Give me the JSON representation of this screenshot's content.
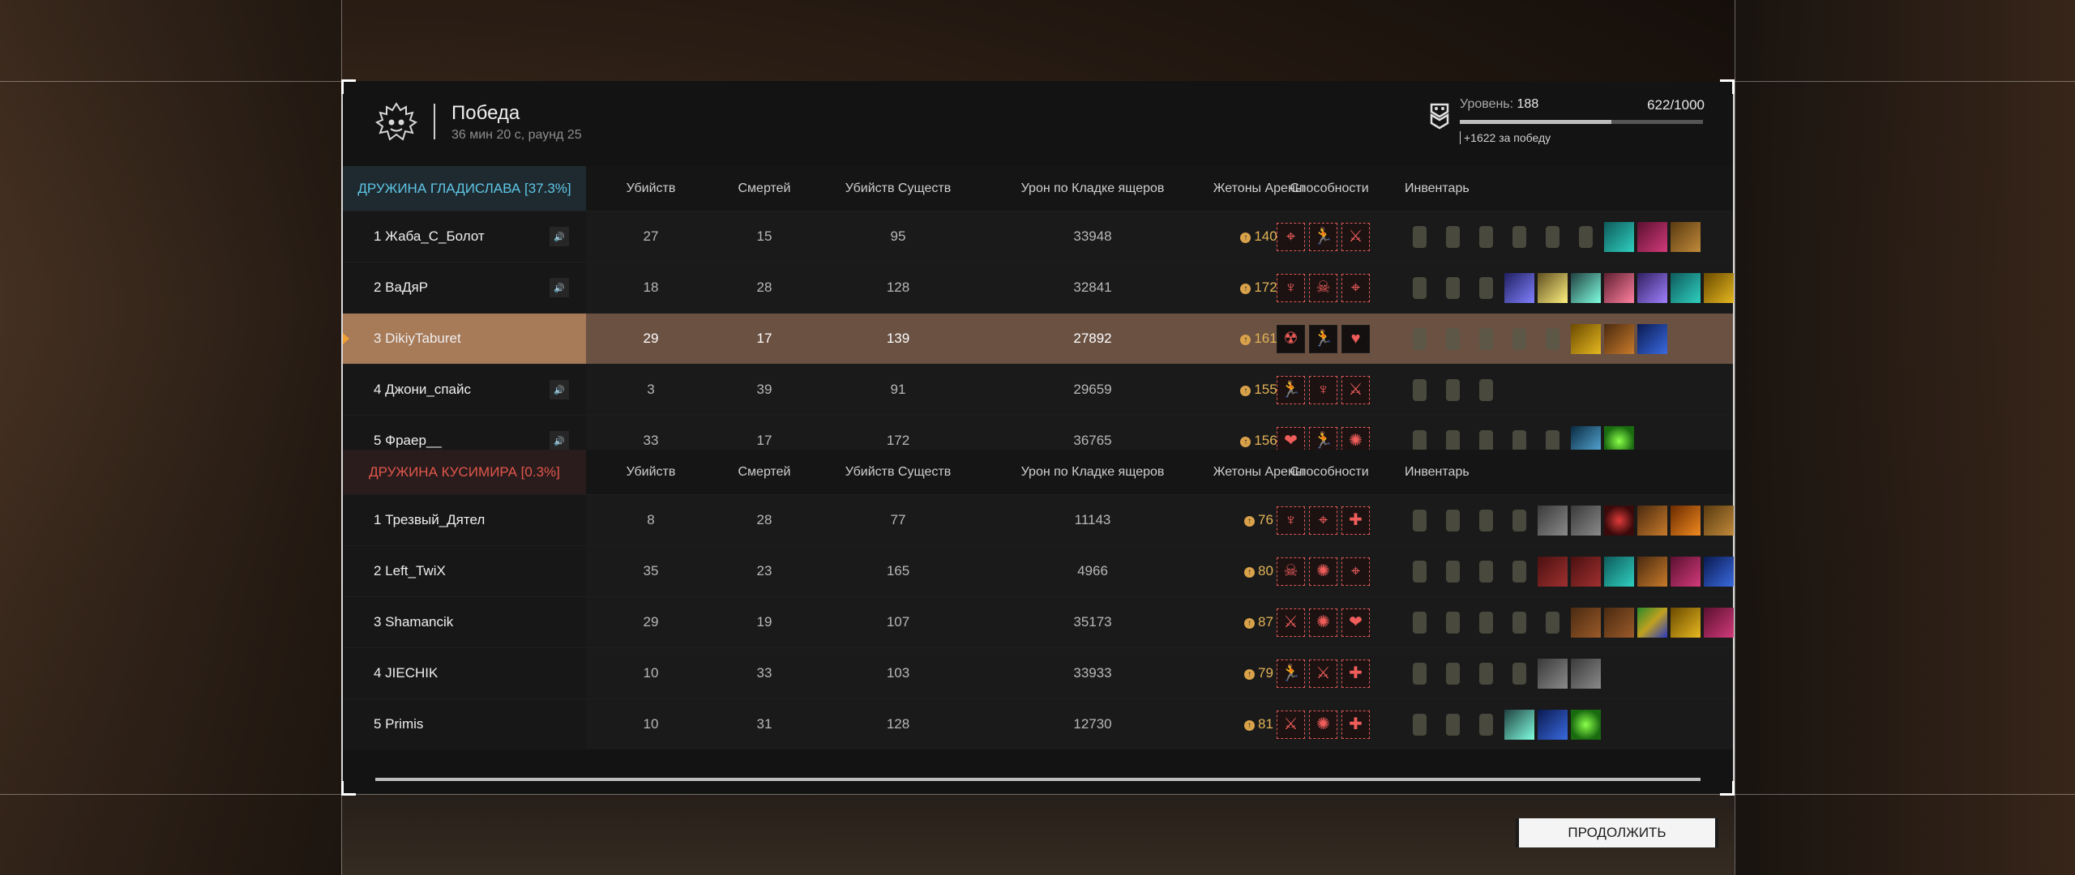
{
  "header": {
    "title": "Победа",
    "subtitle": "36 мин 20 с, раунд 25",
    "level_label": "Уровень:",
    "level_value": "188",
    "xp": "622/1000",
    "xp_fraction": 0.622,
    "bonus": "+1622 за победу"
  },
  "columns": [
    "Убийств",
    "Смертей",
    "Убийств Существ",
    "Урон по Кладке ящеров",
    "Жетоны Арены",
    "Способности",
    "Инвентарь"
  ],
  "teams": [
    {
      "name": "ДРУЖИНА ГЛАДИСЛАВА [37.3%]",
      "color": "#5ec6e6",
      "players": [
        {
          "name": "1 Жаба_С_Болот",
          "kills": "27",
          "deaths": "15",
          "creatures": "95",
          "damage": "33948",
          "tokens": "140",
          "speaker": true,
          "highlighted": false,
          "abilities": [
            "crosshair-icon",
            "runner-icon",
            "slash-icon"
          ],
          "inventory": [
            "armor",
            "grenade",
            "flask",
            "stick",
            "rod",
            "knife",
            "teal",
            "magenta",
            "crate"
          ]
        },
        {
          "name": "2 ВаДяР",
          "kills": "18",
          "deaths": "28",
          "creatures": "128",
          "damage": "32841",
          "tokens": "172",
          "speaker": true,
          "highlighted": false,
          "abilities": [
            "wings-icon",
            "demon-icon",
            "crosshair-icon"
          ],
          "inventory": [
            "armor",
            "grenade",
            "rifle",
            "disk-blue",
            "disk-yellow",
            "disk-teal",
            "disk-pink",
            "disk-purple",
            "teal",
            "gold"
          ]
        },
        {
          "name": "3 DikiyTaburet",
          "kills": "29",
          "deaths": "17",
          "creatures": "139",
          "damage": "27892",
          "tokens": "161",
          "speaker": false,
          "highlighted": true,
          "abilities": [
            "radiation-icon",
            "runner-icon",
            "heart-drop-icon"
          ],
          "inventory": [
            "armor",
            "grenade",
            "bomb",
            "rifle",
            "rod",
            "gold",
            "boots",
            "blue"
          ]
        },
        {
          "name": "4 Джони_спайс",
          "kills": "3",
          "deaths": "39",
          "creatures": "91",
          "damage": "29659",
          "tokens": "155",
          "speaker": true,
          "highlighted": false,
          "abilities": [
            "runner-icon",
            "wings-icon",
            "slash-icon"
          ],
          "inventory": [
            "armor",
            "grenade",
            "stick"
          ]
        },
        {
          "name": "5 Фраер__",
          "kills": "33",
          "deaths": "17",
          "creatures": "172",
          "damage": "36765",
          "tokens": "156",
          "speaker": true,
          "highlighted": false,
          "abilities": [
            "heart-icon",
            "runner-icon",
            "brain-icon"
          ],
          "inventory": [
            "armor",
            "grenade",
            "flask",
            "rod",
            "rifle",
            "ice",
            "green-orb"
          ]
        }
      ]
    },
    {
      "name": "ДРУЖИНА КУСИМИРА [0.3%]",
      "color": "#e2574c",
      "players": [
        {
          "name": "1 Трезвый_Дятел",
          "kills": "8",
          "deaths": "28",
          "creatures": "77",
          "damage": "11143",
          "tokens": "76",
          "speaker": false,
          "highlighted": false,
          "abilities": [
            "wings-icon",
            "crosshair-icon",
            "cross-target-icon"
          ],
          "inventory": [
            "armor",
            "grenade",
            "flask",
            "rifle",
            "gray",
            "gray",
            "red-orb",
            "boots",
            "orange",
            "crate"
          ]
        },
        {
          "name": "2 Left_TwiX",
          "kills": "35",
          "deaths": "23",
          "creatures": "165",
          "damage": "4966",
          "tokens": "80",
          "speaker": false,
          "highlighted": false,
          "abilities": [
            "demon-icon",
            "brain-icon",
            "crosshair-icon"
          ],
          "inventory": [
            "armor",
            "grenade",
            "stick",
            "rifle",
            "maroon",
            "maroon",
            "teal",
            "boots",
            "magenta",
            "blue"
          ]
        },
        {
          "name": "3 Shamancik",
          "kills": "29",
          "deaths": "19",
          "creatures": "107",
          "damage": "35173",
          "tokens": "87",
          "speaker": false,
          "highlighted": false,
          "abilities": [
            "slash-icon",
            "brain-icon",
            "heart-icon"
          ],
          "inventory": [
            "armor",
            "grenade",
            "green-flask",
            "rifle",
            "rod",
            "brown",
            "brown",
            "multi",
            "gold",
            "magenta"
          ]
        },
        {
          "name": "4 JIECHIK",
          "kills": "10",
          "deaths": "33",
          "creatures": "103",
          "damage": "33933",
          "tokens": "79",
          "speaker": false,
          "highlighted": false,
          "abilities": [
            "runner-icon",
            "slash-icon",
            "cross-target-icon"
          ],
          "inventory": [
            "armor",
            "grenade",
            "flask",
            "rifle",
            "gray",
            "gray"
          ]
        },
        {
          "name": "5 Primis",
          "kills": "10",
          "deaths": "31",
          "creatures": "128",
          "damage": "12730",
          "tokens": "81",
          "speaker": false,
          "highlighted": false,
          "abilities": [
            "slash-icon",
            "brain-icon",
            "cross-target-icon"
          ],
          "inventory": [
            "armor",
            "grenade",
            "stick",
            "disk-teal",
            "blue",
            "green-orb"
          ]
        }
      ]
    }
  ],
  "continue_label": "ПРОДОЛЖИТЬ"
}
